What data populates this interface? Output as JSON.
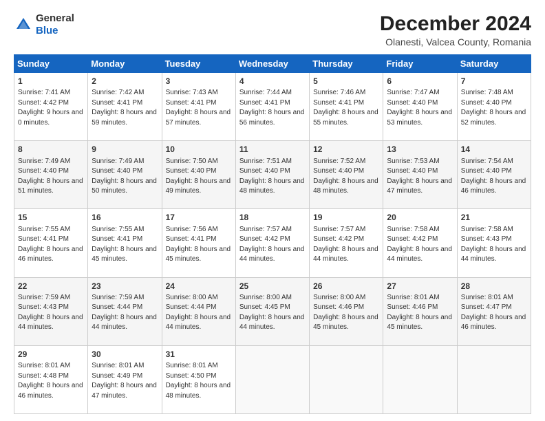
{
  "header": {
    "logo_line1": "General",
    "logo_line2": "Blue",
    "month": "December 2024",
    "location": "Olanesti, Valcea County, Romania"
  },
  "days_of_week": [
    "Sunday",
    "Monday",
    "Tuesday",
    "Wednesday",
    "Thursday",
    "Friday",
    "Saturday"
  ],
  "weeks": [
    [
      {
        "day": "1",
        "sunrise": "Sunrise: 7:41 AM",
        "sunset": "Sunset: 4:42 PM",
        "daylight": "Daylight: 9 hours and 0 minutes."
      },
      {
        "day": "2",
        "sunrise": "Sunrise: 7:42 AM",
        "sunset": "Sunset: 4:41 PM",
        "daylight": "Daylight: 8 hours and 59 minutes."
      },
      {
        "day": "3",
        "sunrise": "Sunrise: 7:43 AM",
        "sunset": "Sunset: 4:41 PM",
        "daylight": "Daylight: 8 hours and 57 minutes."
      },
      {
        "day": "4",
        "sunrise": "Sunrise: 7:44 AM",
        "sunset": "Sunset: 4:41 PM",
        "daylight": "Daylight: 8 hours and 56 minutes."
      },
      {
        "day": "5",
        "sunrise": "Sunrise: 7:46 AM",
        "sunset": "Sunset: 4:41 PM",
        "daylight": "Daylight: 8 hours and 55 minutes."
      },
      {
        "day": "6",
        "sunrise": "Sunrise: 7:47 AM",
        "sunset": "Sunset: 4:40 PM",
        "daylight": "Daylight: 8 hours and 53 minutes."
      },
      {
        "day": "7",
        "sunrise": "Sunrise: 7:48 AM",
        "sunset": "Sunset: 4:40 PM",
        "daylight": "Daylight: 8 hours and 52 minutes."
      }
    ],
    [
      {
        "day": "8",
        "sunrise": "Sunrise: 7:49 AM",
        "sunset": "Sunset: 4:40 PM",
        "daylight": "Daylight: 8 hours and 51 minutes."
      },
      {
        "day": "9",
        "sunrise": "Sunrise: 7:49 AM",
        "sunset": "Sunset: 4:40 PM",
        "daylight": "Daylight: 8 hours and 50 minutes."
      },
      {
        "day": "10",
        "sunrise": "Sunrise: 7:50 AM",
        "sunset": "Sunset: 4:40 PM",
        "daylight": "Daylight: 8 hours and 49 minutes."
      },
      {
        "day": "11",
        "sunrise": "Sunrise: 7:51 AM",
        "sunset": "Sunset: 4:40 PM",
        "daylight": "Daylight: 8 hours and 48 minutes."
      },
      {
        "day": "12",
        "sunrise": "Sunrise: 7:52 AM",
        "sunset": "Sunset: 4:40 PM",
        "daylight": "Daylight: 8 hours and 48 minutes."
      },
      {
        "day": "13",
        "sunrise": "Sunrise: 7:53 AM",
        "sunset": "Sunset: 4:40 PM",
        "daylight": "Daylight: 8 hours and 47 minutes."
      },
      {
        "day": "14",
        "sunrise": "Sunrise: 7:54 AM",
        "sunset": "Sunset: 4:40 PM",
        "daylight": "Daylight: 8 hours and 46 minutes."
      }
    ],
    [
      {
        "day": "15",
        "sunrise": "Sunrise: 7:55 AM",
        "sunset": "Sunset: 4:41 PM",
        "daylight": "Daylight: 8 hours and 46 minutes."
      },
      {
        "day": "16",
        "sunrise": "Sunrise: 7:55 AM",
        "sunset": "Sunset: 4:41 PM",
        "daylight": "Daylight: 8 hours and 45 minutes."
      },
      {
        "day": "17",
        "sunrise": "Sunrise: 7:56 AM",
        "sunset": "Sunset: 4:41 PM",
        "daylight": "Daylight: 8 hours and 45 minutes."
      },
      {
        "day": "18",
        "sunrise": "Sunrise: 7:57 AM",
        "sunset": "Sunset: 4:42 PM",
        "daylight": "Daylight: 8 hours and 44 minutes."
      },
      {
        "day": "19",
        "sunrise": "Sunrise: 7:57 AM",
        "sunset": "Sunset: 4:42 PM",
        "daylight": "Daylight: 8 hours and 44 minutes."
      },
      {
        "day": "20",
        "sunrise": "Sunrise: 7:58 AM",
        "sunset": "Sunset: 4:42 PM",
        "daylight": "Daylight: 8 hours and 44 minutes."
      },
      {
        "day": "21",
        "sunrise": "Sunrise: 7:58 AM",
        "sunset": "Sunset: 4:43 PM",
        "daylight": "Daylight: 8 hours and 44 minutes."
      }
    ],
    [
      {
        "day": "22",
        "sunrise": "Sunrise: 7:59 AM",
        "sunset": "Sunset: 4:43 PM",
        "daylight": "Daylight: 8 hours and 44 minutes."
      },
      {
        "day": "23",
        "sunrise": "Sunrise: 7:59 AM",
        "sunset": "Sunset: 4:44 PM",
        "daylight": "Daylight: 8 hours and 44 minutes."
      },
      {
        "day": "24",
        "sunrise": "Sunrise: 8:00 AM",
        "sunset": "Sunset: 4:44 PM",
        "daylight": "Daylight: 8 hours and 44 minutes."
      },
      {
        "day": "25",
        "sunrise": "Sunrise: 8:00 AM",
        "sunset": "Sunset: 4:45 PM",
        "daylight": "Daylight: 8 hours and 44 minutes."
      },
      {
        "day": "26",
        "sunrise": "Sunrise: 8:00 AM",
        "sunset": "Sunset: 4:46 PM",
        "daylight": "Daylight: 8 hours and 45 minutes."
      },
      {
        "day": "27",
        "sunrise": "Sunrise: 8:01 AM",
        "sunset": "Sunset: 4:46 PM",
        "daylight": "Daylight: 8 hours and 45 minutes."
      },
      {
        "day": "28",
        "sunrise": "Sunrise: 8:01 AM",
        "sunset": "Sunset: 4:47 PM",
        "daylight": "Daylight: 8 hours and 46 minutes."
      }
    ],
    [
      {
        "day": "29",
        "sunrise": "Sunrise: 8:01 AM",
        "sunset": "Sunset: 4:48 PM",
        "daylight": "Daylight: 8 hours and 46 minutes."
      },
      {
        "day": "30",
        "sunrise": "Sunrise: 8:01 AM",
        "sunset": "Sunset: 4:49 PM",
        "daylight": "Daylight: 8 hours and 47 minutes."
      },
      {
        "day": "31",
        "sunrise": "Sunrise: 8:01 AM",
        "sunset": "Sunset: 4:50 PM",
        "daylight": "Daylight: 8 hours and 48 minutes."
      },
      null,
      null,
      null,
      null
    ]
  ]
}
